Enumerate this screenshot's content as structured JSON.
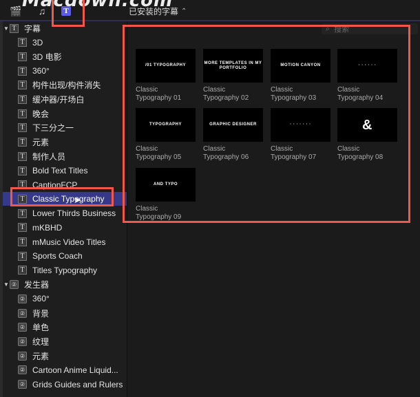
{
  "watermark": "Macdown.com",
  "toolbar": {
    "icons": [
      "clapper-icon",
      "music-photo-icon",
      "titles-icon"
    ],
    "dropdown_label": "已安装的字幕",
    "dropdown_chevron": "⌃⌄"
  },
  "search": {
    "placeholder": "搜索",
    "icon": "🔍"
  },
  "sidebar": {
    "groups": [
      {
        "label": "字幕",
        "icon": "T",
        "expanded": true,
        "items": [
          {
            "label": "3D"
          },
          {
            "label": "3D 电影"
          },
          {
            "label": "360°"
          },
          {
            "label": "构件出现/构件消失"
          },
          {
            "label": "缓冲器/开场白"
          },
          {
            "label": "晚会"
          },
          {
            "label": "下三分之一"
          },
          {
            "label": "元素"
          },
          {
            "label": "制作人员"
          },
          {
            "label": "Bold Text Titles"
          },
          {
            "label": "CaptionFCP"
          },
          {
            "label": "Classic Typography",
            "selected": true
          },
          {
            "label": "Lower Thirds Business"
          },
          {
            "label": "mKBHD"
          },
          {
            "label": "mMusic Video Titles"
          },
          {
            "label": "Sports Coach"
          },
          {
            "label": "Titles Typography"
          }
        ]
      },
      {
        "label": "发生器",
        "icon": "②",
        "expanded": true,
        "items": [
          {
            "label": "360°"
          },
          {
            "label": "背景"
          },
          {
            "label": "单色"
          },
          {
            "label": "纹理"
          },
          {
            "label": "元素"
          },
          {
            "label": "Cartoon Anime Liquid..."
          },
          {
            "label": "Grids Guides and Rulers"
          }
        ]
      }
    ]
  },
  "tiles": [
    {
      "line1": "Classic",
      "line2": "Typography 01",
      "thumb_text": "/01 TYPOGRAPHY"
    },
    {
      "line1": "Classic",
      "line2": "Typography 02",
      "thumb_text": "MORE TEMPLATES IN MY PORTFOLIO"
    },
    {
      "line1": "Classic",
      "line2": "Typography 03",
      "thumb_text": "MOTION CANYON"
    },
    {
      "line1": "Classic",
      "line2": "Typography 04",
      "thumb_text": "· ·  · ·  · ·"
    },
    {
      "line1": "Classic",
      "line2": "Typography 05",
      "thumb_text": "TYPOGRAPHY"
    },
    {
      "line1": "Classic",
      "line2": "Typography 06",
      "thumb_text": "GRAPHIC DESIGNER"
    },
    {
      "line1": "Classic",
      "line2": "Typography 07",
      "thumb_text": "· · · · · · ·"
    },
    {
      "line1": "Classic",
      "line2": "Typography 08",
      "thumb_text": "&"
    },
    {
      "line1": "Classic",
      "line2": "Typography 09",
      "thumb_text": "AND TYPO"
    }
  ],
  "colors": {
    "accent": "#36388a",
    "highlight_box": "#f2574a",
    "titles_icon": "#5b5be8"
  }
}
